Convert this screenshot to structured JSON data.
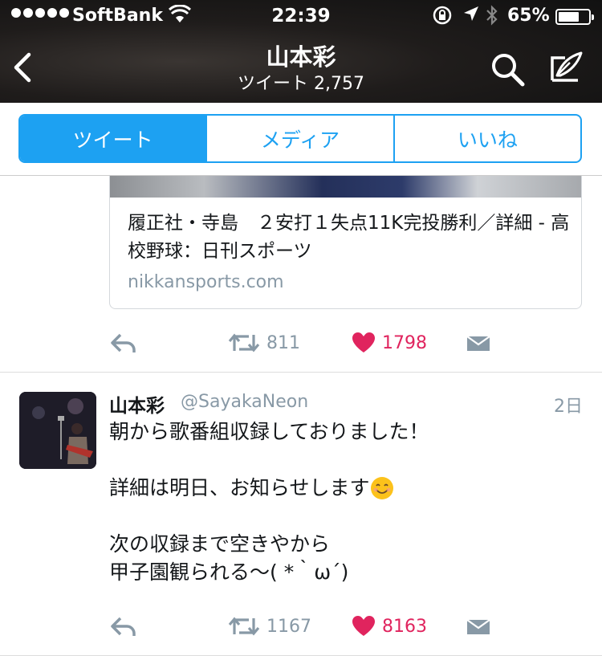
{
  "status_bar": {
    "carrier": "SoftBank",
    "time": "22:39",
    "battery_percent": "65%",
    "battery_level": 0.65
  },
  "nav": {
    "title": "山本彩",
    "subtitle": "ツイート 2,757"
  },
  "tabs": [
    {
      "label": "ツイート",
      "active": true
    },
    {
      "label": "メディア",
      "active": false
    },
    {
      "label": "いいね",
      "active": false
    }
  ],
  "previous_tweet": {
    "card": {
      "title": "履正社・寺島　２安打１失点11K完投勝利／詳細 - 高校野球：日刊スポーツ",
      "domain": "nikkansports.com"
    },
    "retweets": "811",
    "likes": "1798"
  },
  "tweet": {
    "name": "山本彩",
    "handle": "@SayakaNeon",
    "time": "2日",
    "text_line1": "朝から歌番組収録しておりました！",
    "text_line2": "詳細は明日、お知らせします",
    "text_line3": "次の収録まで空きやから",
    "text_line4": "甲子園観られる〜( *｀ω´)",
    "retweets": "1167",
    "likes": "8163"
  },
  "colors": {
    "accent": "#1da1f2",
    "like": "#e0245e",
    "muted": "#8899a6"
  }
}
